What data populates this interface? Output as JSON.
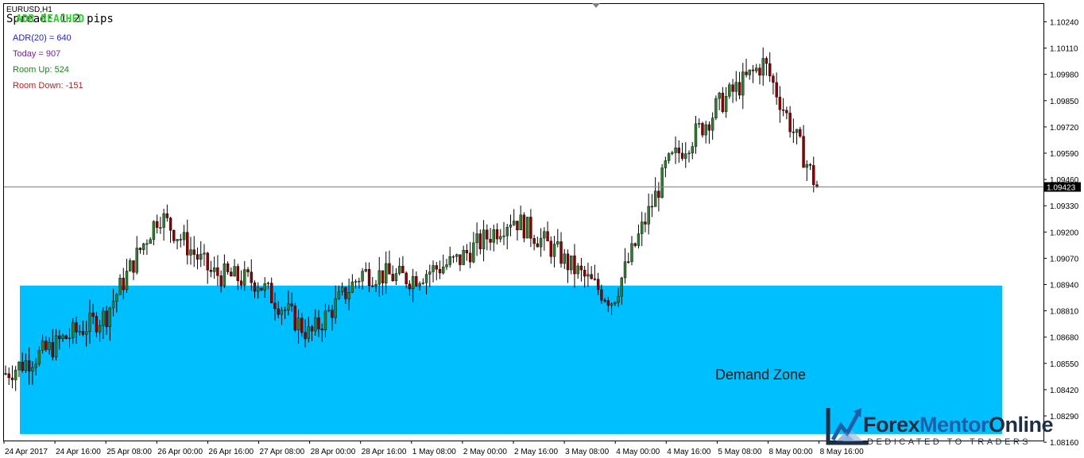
{
  "header": {
    "symbol": "EURUSD,H1",
    "spread_text": "Spread: 1.2 pips",
    "status_text": "ADR REACHED"
  },
  "indicators": {
    "adr": "ADR(20) = 640",
    "today": "Today = 907",
    "room_up": "Room Up: 524",
    "room_down": "Room Down: -151"
  },
  "zone": {
    "label": "Demand Zone",
    "color": "#00bfff",
    "price_low": 1.082,
    "price_high": 1.08935
  },
  "logo": {
    "part1": "Forex",
    "part2": "Mentor",
    "part3": "Online",
    "tagline": "DEDICATED TO TRADERS"
  },
  "colors": {
    "bull": "#2e7d32",
    "bear": "#8b0000",
    "wick": "#000000",
    "price_line": "#808080",
    "grid_text": "#000000"
  },
  "chart_data": {
    "type": "candlestick",
    "title": "EURUSD,H1",
    "current_price": "1.09423",
    "ylim": [
      1.082,
      1.1027
    ],
    "y_ticks": [
      "1.10240",
      "1.10110",
      "1.09980",
      "1.09850",
      "1.09720",
      "1.09590",
      "1.09460",
      "1.09330",
      "1.09200",
      "1.09070",
      "1.08940",
      "1.08810",
      "1.08680",
      "1.08550",
      "1.08420",
      "1.08290",
      "1.08160"
    ],
    "x_tick_labels": [
      "24 Apr 2017",
      "24 Apr 16:00",
      "25 Apr 08:00",
      "26 Apr 00:00",
      "26 Apr 16:00",
      "27 Apr 08:00",
      "28 Apr 00:00",
      "28 Apr 16:00",
      "1 May 08:00",
      "2 May 00:00",
      "2 May 16:00",
      "3 May 08:00",
      "4 May 00:00",
      "4 May 16:00",
      "5 May 08:00",
      "8 May 00:00",
      "8 May 16:00"
    ],
    "closes_by_segment": [
      {
        "from": "24 Apr 2017",
        "to": "24 Apr 16:00",
        "from_close": 1.085,
        "to_close": 1.0865
      },
      {
        "from": "24 Apr 16:00",
        "to": "25 Apr 08:00",
        "from_close": 1.0865,
        "to_close": 1.088
      },
      {
        "from": "25 Apr 08:00",
        "to": "26 Apr 00:00",
        "from_close": 1.088,
        "to_close": 1.093
      },
      {
        "from": "26 Apr 00:00",
        "to": "26 Apr 16:00",
        "from_close": 1.093,
        "to_close": 1.09
      },
      {
        "from": "26 Apr 16:00",
        "to": "27 Apr 08:00",
        "from_close": 1.09,
        "to_close": 1.0895
      },
      {
        "from": "27 Apr 08:00",
        "to": "28 Apr 00:00",
        "from_close": 1.0895,
        "to_close": 1.0868
      },
      {
        "from": "28 Apr 00:00",
        "to": "28 Apr 16:00",
        "from_close": 1.0868,
        "to_close": 1.09
      },
      {
        "from": "28 Apr 16:00",
        "to": "1 May 08:00",
        "from_close": 1.09,
        "to_close": 1.0897
      },
      {
        "from": "1 May 08:00",
        "to": "2 May 00:00",
        "from_close": 1.0897,
        "to_close": 1.0907
      },
      {
        "from": "2 May 00:00",
        "to": "2 May 16:00",
        "from_close": 1.0907,
        "to_close": 1.0928
      },
      {
        "from": "2 May 16:00",
        "to": "3 May 08:00",
        "from_close": 1.0928,
        "to_close": 1.0907
      },
      {
        "from": "3 May 08:00",
        "to": "4 May 00:00",
        "from_close": 1.0907,
        "to_close": 1.0885
      },
      {
        "from": "4 May 00:00",
        "to": "4 May 16:00",
        "from_close": 1.0885,
        "to_close": 1.095
      },
      {
        "from": "4 May 16:00",
        "to": "5 May 08:00",
        "from_close": 1.095,
        "to_close": 1.098
      },
      {
        "from": "5 May 08:00",
        "to": "8 May 00:00",
        "from_close": 1.098,
        "to_close": 1.1005
      },
      {
        "from": "8 May 00:00",
        "to": "8 May 16:00",
        "from_close": 1.1005,
        "to_close": 1.0942
      }
    ]
  }
}
